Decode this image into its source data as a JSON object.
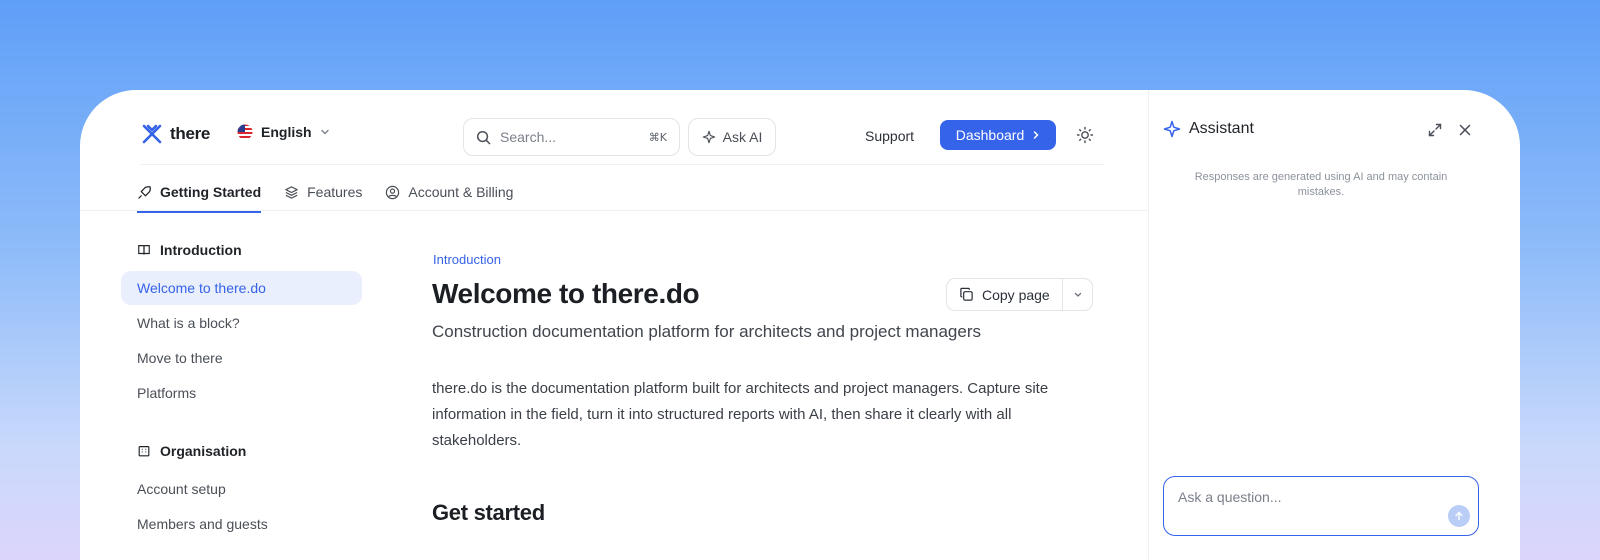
{
  "brand": {
    "name": "there"
  },
  "header": {
    "language": "English",
    "search_placeholder": "Search...",
    "search_shortcut": "⌘K",
    "ask_ai_label": "Ask AI",
    "support_label": "Support",
    "dashboard_label": "Dashboard"
  },
  "tabs": [
    {
      "label": "Getting Started",
      "icon": "rocket-icon",
      "active": true
    },
    {
      "label": "Features",
      "icon": "layers-icon"
    },
    {
      "label": "Account & Billing",
      "icon": "user-circle-icon"
    }
  ],
  "sidebar": {
    "sections": [
      {
        "title": "Introduction",
        "icon": "book-icon",
        "items": [
          "Welcome to there.do",
          "What is a block?",
          "Move to there",
          "Platforms"
        ]
      },
      {
        "title": "Organisation",
        "icon": "building-icon",
        "items": [
          "Account setup",
          "Members and guests"
        ]
      }
    ],
    "active_item": "Welcome to there.do"
  },
  "content": {
    "breadcrumb": "Introduction",
    "title": "Welcome to there.do",
    "copy_label": "Copy page",
    "subtitle": "Construction documentation platform for architects and project managers",
    "body": "there.do is the documentation platform built for architects and project managers. Capture site information in the field, turn it into structured reports with AI, then share it clearly with all stakeholders.",
    "section_heading": "Get started"
  },
  "assistant": {
    "title": "Assistant",
    "disclaimer": "Responses are generated using AI and may contain mistakes.",
    "input_placeholder": "Ask a question..."
  },
  "colors": {
    "accent": "#3563e9",
    "active_bg": "#eaeffd"
  }
}
